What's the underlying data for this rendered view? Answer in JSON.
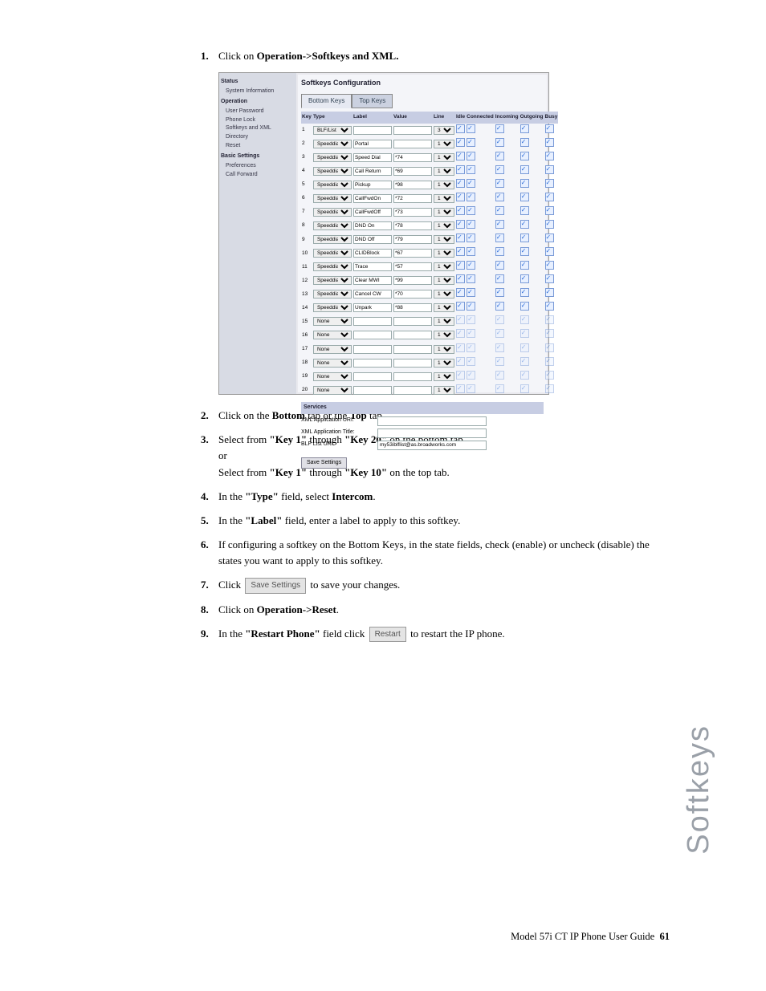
{
  "steps": {
    "s1a": "Click on ",
    "s1b": "Operation->Softkeys and XML.",
    "s2a": "Click on the ",
    "s2b": "Bottom",
    "s2c": " tab or the ",
    "s2d": "Top",
    "s2e": " tab.",
    "s3a": "Select from ",
    "s3b": "\"Key 1\"",
    "s3c": " through ",
    "s3d": "\"Key 20\"",
    "s3e": " on the bottom tab.",
    "s3or": "or",
    "s3f": "Select from ",
    "s3g": "\"Key 1\"",
    "s3h": " through ",
    "s3i": "\"Key 10\"",
    "s3j": " on the top tab.",
    "s4a": "In the ",
    "s4b": "\"Type\"",
    "s4c": " field, select ",
    "s4d": "Intercom",
    "s4e": ".",
    "s5a": "In the ",
    "s5b": "\"Label\"",
    "s5c": " field, enter a label to apply to this softkey.",
    "s6": "If configuring a softkey on the Bottom Keys, in the state fields, check (enable) or uncheck (disable) the states you want to apply to this softkey.",
    "s7a": "Click ",
    "s7btn": "Save Settings",
    "s7b": " to save your changes.",
    "s8a": "Click on ",
    "s8b": "Operation->Reset",
    "s8c": ".",
    "s9a": "In the ",
    "s9b": "\"Restart Phone\"",
    "s9c": " field click ",
    "s9btn": "Restart",
    "s9d": " to restart the IP phone."
  },
  "screenshot": {
    "title": "Softkeys Configuration",
    "tabs": {
      "bottom": "Bottom Keys",
      "top": "Top Keys"
    },
    "sidebar": {
      "status": "Status",
      "sysinfo": "System Information",
      "operation": "Operation",
      "userpw": "User Password",
      "phonelock": "Phone Lock",
      "softkeys": "Softkeys and XML",
      "directory": "Directory",
      "reset": "Reset",
      "basic": "Basic Settings",
      "prefs": "Preferences",
      "callfwd": "Call Forward"
    },
    "headers": [
      "Key",
      "Type",
      "Label",
      "Value",
      "Line",
      "Idle",
      "Connected",
      "Incoming",
      "Outgoing",
      "Busy"
    ],
    "rows": [
      {
        "key": "1",
        "type": "BLF/List",
        "label": "",
        "value": "",
        "line": "3",
        "enabled": true
      },
      {
        "key": "2",
        "type": "Speeddial",
        "label": "Portal",
        "value": "",
        "line": "1",
        "enabled": true
      },
      {
        "key": "3",
        "type": "Speeddial",
        "label": "Speed Dial",
        "value": "*74",
        "line": "1",
        "enabled": true
      },
      {
        "key": "4",
        "type": "Speeddial",
        "label": "Call Return",
        "value": "*69",
        "line": "1",
        "enabled": true
      },
      {
        "key": "5",
        "type": "Speeddial",
        "label": "Pickup",
        "value": "*98",
        "line": "1",
        "enabled": true
      },
      {
        "key": "6",
        "type": "Speeddial",
        "label": "CallFwdOn",
        "value": "*72",
        "line": "1",
        "enabled": true
      },
      {
        "key": "7",
        "type": "Speeddial",
        "label": "CallFwdOff",
        "value": "*73",
        "line": "1",
        "enabled": true
      },
      {
        "key": "8",
        "type": "Speeddial",
        "label": "DND On",
        "value": "*78",
        "line": "1",
        "enabled": true
      },
      {
        "key": "9",
        "type": "Speeddial",
        "label": "DND Off",
        "value": "*79",
        "line": "1",
        "enabled": true
      },
      {
        "key": "10",
        "type": "Speeddial",
        "label": "CLIDBlock",
        "value": "*67",
        "line": "1",
        "enabled": true
      },
      {
        "key": "11",
        "type": "Speeddial",
        "label": "Trace",
        "value": "*57",
        "line": "1",
        "enabled": true
      },
      {
        "key": "12",
        "type": "Speeddial",
        "label": "Clear MWI",
        "value": "*99",
        "line": "1",
        "enabled": true
      },
      {
        "key": "13",
        "type": "Speeddial",
        "label": "Cancel CW",
        "value": "*70",
        "line": "1",
        "enabled": true
      },
      {
        "key": "14",
        "type": "Speeddial",
        "label": "Unpark",
        "value": "*88",
        "line": "1",
        "enabled": true
      },
      {
        "key": "15",
        "type": "None",
        "label": "",
        "value": "",
        "line": "1",
        "enabled": false
      },
      {
        "key": "16",
        "type": "None",
        "label": "",
        "value": "",
        "line": "1",
        "enabled": false
      },
      {
        "key": "17",
        "type": "None",
        "label": "",
        "value": "",
        "line": "1",
        "enabled": false
      },
      {
        "key": "18",
        "type": "None",
        "label": "",
        "value": "",
        "line": "1",
        "enabled": false
      },
      {
        "key": "19",
        "type": "None",
        "label": "",
        "value": "",
        "line": "1",
        "enabled": false
      },
      {
        "key": "20",
        "type": "None",
        "label": "",
        "value": "",
        "line": "1",
        "enabled": false
      }
    ],
    "services": {
      "header": "Services",
      "xml_uri_lbl": "XML Application URI:",
      "xml_title_lbl": "XML Application Title:",
      "blf_lbl": "BLF List URI:",
      "blf_val": "my53iblflist@as.broadworks.com",
      "save": "Save Settings"
    }
  },
  "side_label": "Softkeys",
  "footer": {
    "book": "Model 57i CT IP Phone User Guide",
    "page": "61"
  }
}
